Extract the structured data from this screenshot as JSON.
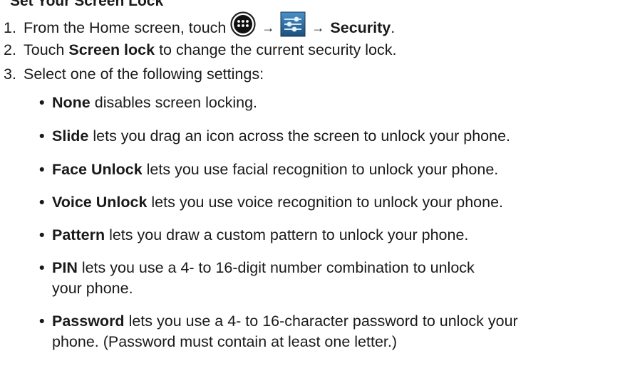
{
  "heading_partial": "Set Your Screen Lock",
  "steps": [
    {
      "number": "1.",
      "text_before": "From the Home screen, touch",
      "arrow1": "→",
      "arrow2": "→",
      "target": "Security",
      "end": "."
    },
    {
      "number": "2.",
      "text_before": "Touch",
      "bold": "Screen lock",
      "text_after": "to change the current security lock."
    },
    {
      "number": "3.",
      "text": "Select one of the following settings:"
    }
  ],
  "icons": {
    "apps": "apps-launcher-icon",
    "settings": "settings-sliders-icon"
  },
  "options": [
    {
      "name": "None",
      "desc": "disables screen locking."
    },
    {
      "name": "Slide",
      "desc": "lets you drag an icon across the screen to unlock your phone."
    },
    {
      "name": "Face Unlock",
      "desc": "lets you use facial recognition to unlock your phone."
    },
    {
      "name": "Voice Unlock",
      "desc": "lets you use voice recognition to unlock your phone."
    },
    {
      "name": "Pattern",
      "desc": "lets you draw a custom pattern to unlock your phone."
    },
    {
      "name": "PIN",
      "desc": "lets you use a 4- to 16-digit number combination to unlock",
      "desc2": "your phone."
    },
    {
      "name": "Password",
      "desc": "lets you use a 4- to 16-character password to unlock your",
      "desc2": "phone. (Password must contain at least one letter.)"
    }
  ]
}
